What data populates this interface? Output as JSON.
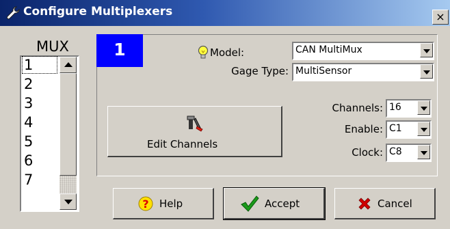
{
  "window": {
    "title": "Configure Multiplexers",
    "close_glyph": "×",
    "title_icon": "wrench-icon"
  },
  "mux": {
    "heading": "MUX",
    "items": [
      "1",
      "2",
      "3",
      "4",
      "5",
      "6",
      "7"
    ],
    "selected_index": 0
  },
  "panel": {
    "number": "1",
    "number_bg": "#0000ff",
    "model": {
      "label": "Model:",
      "value": "CAN MultiMux",
      "icon": "lightbulb-icon"
    },
    "gage_type": {
      "label": "Gage Type:",
      "value": "MultiSensor"
    },
    "channels": {
      "label": "Channels:",
      "value": "16"
    },
    "enable": {
      "label": "Enable:",
      "value": "C1"
    },
    "clock": {
      "label": "Clock:",
      "value": "C8"
    },
    "edit_channels": {
      "label": "Edit Channels",
      "icon": "tools-icon"
    }
  },
  "buttons": {
    "help": {
      "label": "Help",
      "icon": "question-icon"
    },
    "accept": {
      "label": "Accept",
      "icon": "checkmark-icon"
    },
    "cancel": {
      "label": "Cancel",
      "icon": "x-icon"
    }
  }
}
